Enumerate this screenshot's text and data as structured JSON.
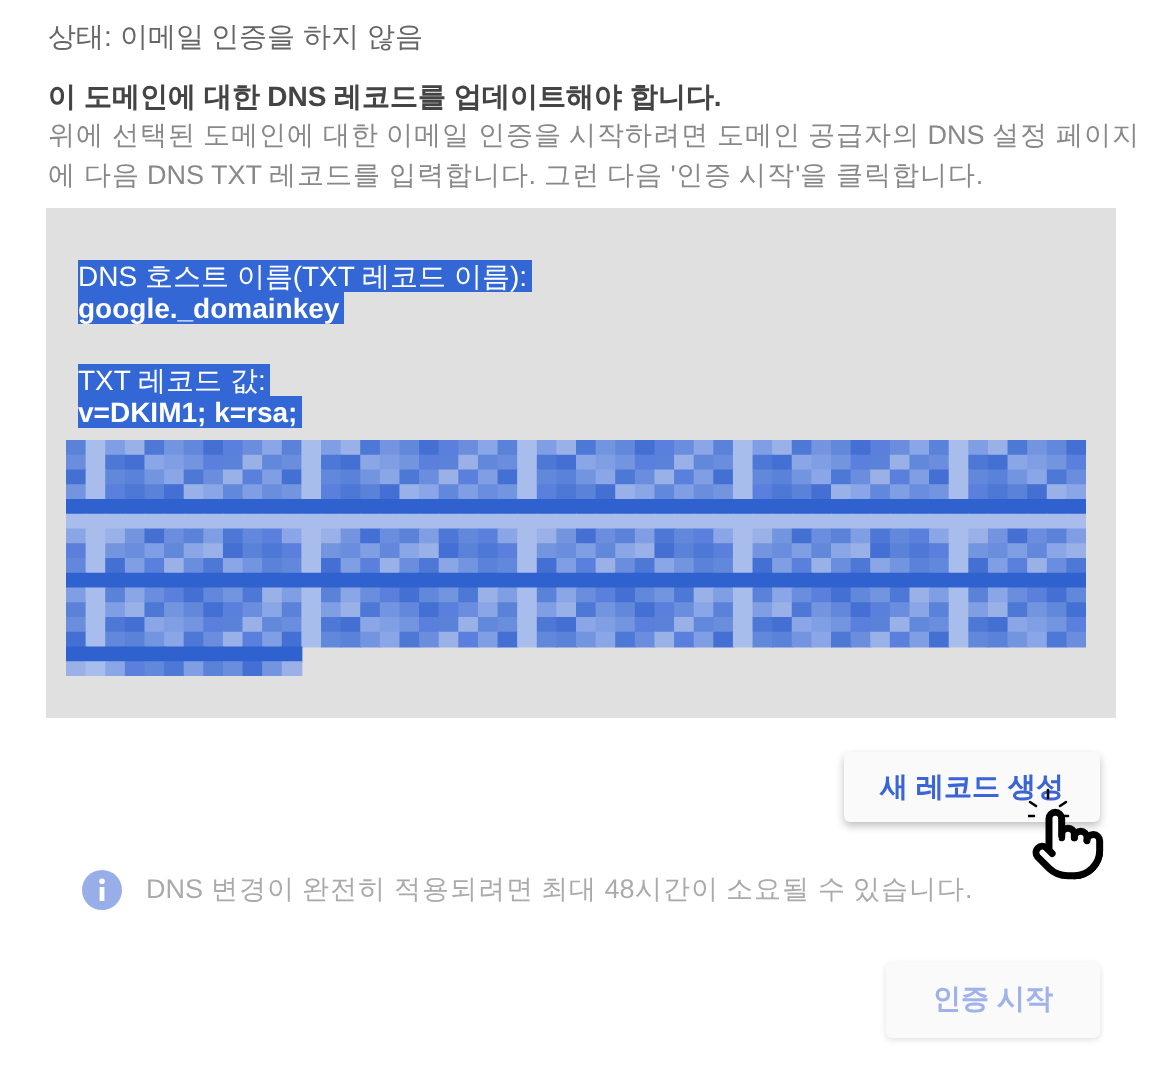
{
  "status": "상태: 이메일 인증을 하지 않음",
  "heading": "이 도메인에 대한 DNS 레코드를 업데이트해야 합니다.",
  "description": "위에 선택된 도메인에 대한 이메일 인증을 시작하려면 도메인 공급자의 DNS 설정 페이지에 다음 DNS TXT 레코드를 입력합니다. 그런 다음 '인증 시작'을 클릭합니다.",
  "record": {
    "selected": true,
    "host_label": "DNS 호스트 이름(TXT 레코드 이름):",
    "host_value": "google._domainkey",
    "value_label": "TXT 레코드 값:",
    "value_prefix": "v=DKIM1; k=rsa;"
  },
  "generate_button": {
    "label": "새 레코드 생성",
    "disabled": false
  },
  "info": "DNS 변경이 완전히 적용되려면 최대 48시간이 소요될 수 있습니다.",
  "start_button": {
    "label": "인증 시작",
    "disabled": true
  }
}
